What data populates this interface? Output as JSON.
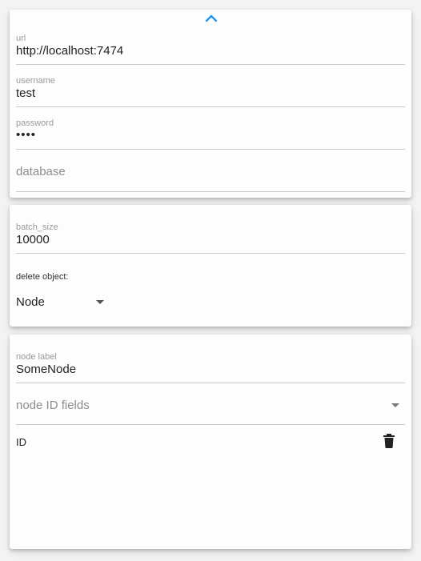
{
  "connection": {
    "url": {
      "label": "url",
      "value": "http://localhost:7474"
    },
    "username": {
      "label": "username",
      "value": "test"
    },
    "password": {
      "label": "password",
      "value": "••••"
    },
    "database": {
      "placeholder": "database"
    }
  },
  "options": {
    "batch_size": {
      "label": "batch_size",
      "value": "10000"
    },
    "delete_object": {
      "label": "delete object:",
      "selected": "Node"
    }
  },
  "node": {
    "label": {
      "label": "node label",
      "value": "SomeNode"
    },
    "id_fields": {
      "placeholder": "node ID fields"
    },
    "items": [
      {
        "label": "ID"
      }
    ]
  },
  "colors": {
    "accent": "#2196f3",
    "background": "#f3f3f3",
    "card": "#fdfdfd"
  },
  "icons": {
    "collapse": "chevron-up-icon",
    "dropdown": "caret-down-icon",
    "delete": "trash-icon"
  }
}
